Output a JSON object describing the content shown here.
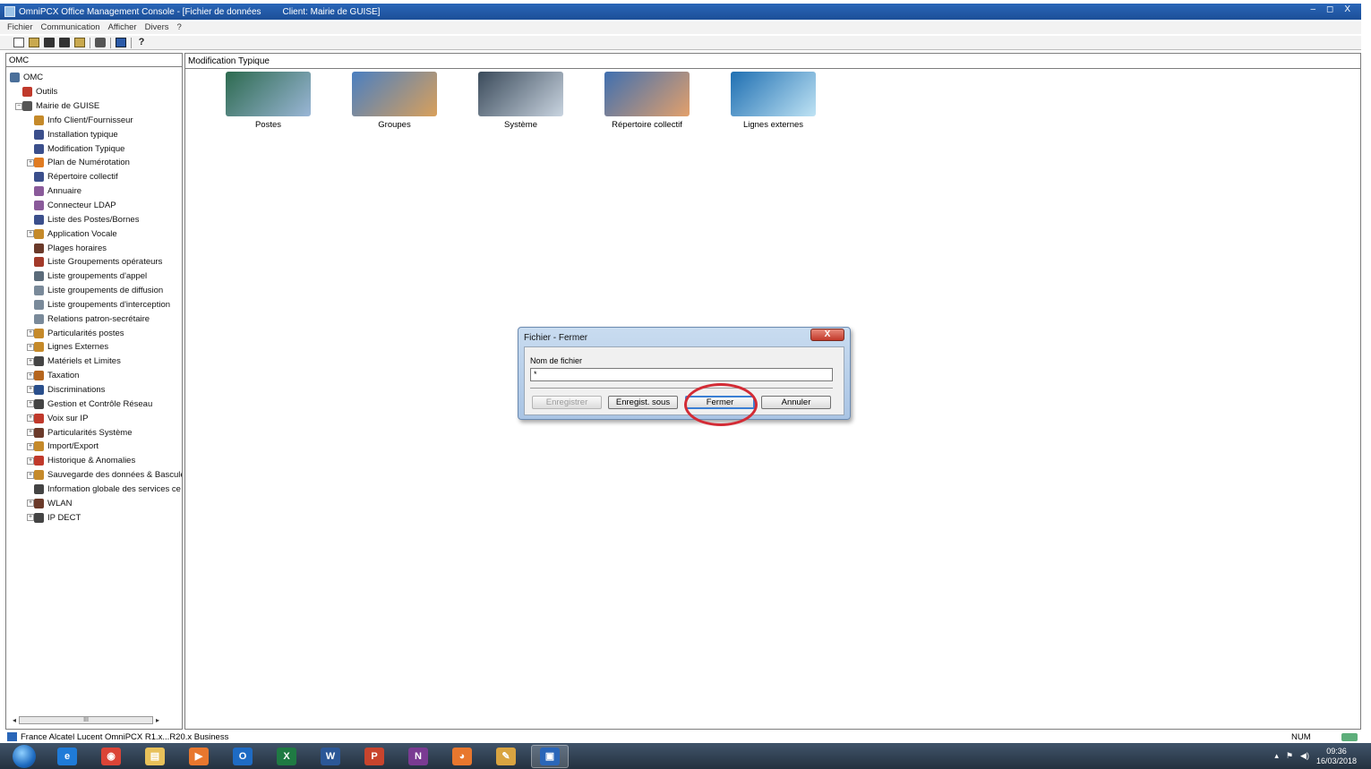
{
  "window": {
    "title": "OmniPCX Office Management Console - [Fichier de données",
    "client": "Client: Mairie de GUISE]",
    "controls": [
      "–",
      "◻",
      "X"
    ]
  },
  "menu": [
    "Fichier",
    "Communication",
    "Afficher",
    "Divers",
    "?"
  ],
  "left_panel": {
    "header": "OMC",
    "tree": [
      {
        "label": "OMC",
        "level": 0,
        "icon_color": "#4a6f9a",
        "icon": "omc-icon",
        "exp": false
      },
      {
        "label": "Outils",
        "level": 1,
        "icon_color": "#c0392b",
        "icon": "tools-icon",
        "exp": false
      },
      {
        "label": "Mairie de GUISE",
        "level": 1,
        "icon_color": "#555555",
        "icon": "computer-icon",
        "exp": true,
        "sign": "−"
      },
      {
        "label": "Info Client/Fournisseur",
        "level": 2,
        "icon_color": "#c58a2a",
        "icon": "info-icon",
        "exp": false
      },
      {
        "label": "Installation typique",
        "level": 2,
        "icon_color": "#3b4f8c",
        "icon": "wizard-icon",
        "exp": false
      },
      {
        "label": "Modification Typique",
        "level": 2,
        "icon_color": "#3b4f8c",
        "icon": "wizard-icon",
        "exp": false
      },
      {
        "label": "Plan de Numérotation",
        "level": 2,
        "icon_color": "#e07b22",
        "icon": "numbering-icon",
        "exp": true,
        "sign": "+"
      },
      {
        "label": "Répertoire collectif",
        "level": 2,
        "icon_color": "#3b4f8c",
        "icon": "directory-icon",
        "exp": false
      },
      {
        "label": "Annuaire",
        "level": 2,
        "icon_color": "#8a5a9a",
        "icon": "phonebook-icon",
        "exp": false
      },
      {
        "label": "Connecteur LDAP",
        "level": 2,
        "icon_color": "#8a5a9a",
        "icon": "ldap-icon",
        "exp": false
      },
      {
        "label": "Liste des Postes/Bornes",
        "level": 2,
        "icon_color": "#3b4f8c",
        "icon": "handset-icon",
        "exp": false
      },
      {
        "label": "Application Vocale",
        "level": 2,
        "icon_color": "#c58a2a",
        "icon": "voice-app-icon",
        "exp": true,
        "sign": "+"
      },
      {
        "label": "Plages horaires",
        "level": 2,
        "icon_color": "#6b3a2a",
        "icon": "clock-icon",
        "exp": false
      },
      {
        "label": "Liste Groupements opérateurs",
        "level": 2,
        "icon_color": "#a33a2a",
        "icon": "operator-group-icon",
        "exp": false
      },
      {
        "label": "Liste groupements d'appel",
        "level": 2,
        "icon_color": "#5b6b7a",
        "icon": "call-group-icon",
        "exp": false
      },
      {
        "label": "Liste groupements de diffusion",
        "level": 2,
        "icon_color": "#7a8a9a",
        "icon": "broadcast-group-icon",
        "exp": false
      },
      {
        "label": "Liste groupements d'interception",
        "level": 2,
        "icon_color": "#7a8a9a",
        "icon": "pickup-group-icon",
        "exp": false
      },
      {
        "label": "Relations patron-secrétaire",
        "level": 2,
        "icon_color": "#7a8a9a",
        "icon": "manager-secretary-icon",
        "exp": false
      },
      {
        "label": "Particularités postes",
        "level": 2,
        "icon_color": "#c58a2a",
        "icon": "station-features-icon",
        "exp": true,
        "sign": "+"
      },
      {
        "label": "Lignes Externes",
        "level": 2,
        "icon_color": "#c58a2a",
        "icon": "external-lines-icon",
        "exp": true,
        "sign": "+"
      },
      {
        "label": "Matériels et Limites",
        "level": 2,
        "icon_color": "#444444",
        "icon": "hardware-icon",
        "exp": true,
        "sign": "+"
      },
      {
        "label": "Taxation",
        "level": 2,
        "icon_color": "#b5651d",
        "icon": "billing-icon",
        "exp": true,
        "sign": "+"
      },
      {
        "label": "Discriminations",
        "level": 2,
        "icon_color": "#2a4f8c",
        "icon": "barring-icon",
        "exp": true,
        "sign": "+"
      },
      {
        "label": "Gestion et Contrôle Réseau",
        "level": 2,
        "icon_color": "#444444",
        "icon": "network-icon",
        "exp": true,
        "sign": "+"
      },
      {
        "label": "Voix sur IP",
        "level": 2,
        "icon_color": "#c0392b",
        "icon": "voip-icon",
        "exp": true,
        "sign": "+"
      },
      {
        "label": "Particularités Système",
        "level": 2,
        "icon_color": "#6b3a2a",
        "icon": "system-features-icon",
        "exp": true,
        "sign": "+"
      },
      {
        "label": "Import/Export",
        "level": 2,
        "icon_color": "#c58a2a",
        "icon": "import-export-icon",
        "exp": true,
        "sign": "+"
      },
      {
        "label": "Historique & Anomalies",
        "level": 2,
        "icon_color": "#c0392b",
        "icon": "history-icon",
        "exp": true,
        "sign": "+"
      },
      {
        "label": "Sauvegarde des données & Bascule",
        "level": 2,
        "icon_color": "#c58a2a",
        "icon": "backup-icon",
        "exp": true,
        "sign": "+"
      },
      {
        "label": "Information globale des services ce",
        "level": 2,
        "icon_color": "#444444",
        "icon": "services-info-icon",
        "exp": false
      },
      {
        "label": "WLAN",
        "level": 2,
        "icon_color": "#6b3a2a",
        "icon": "wlan-icon",
        "exp": true,
        "sign": "+"
      },
      {
        "label": "IP DECT",
        "level": 2,
        "icon_color": "#444444",
        "icon": "ip-dect-icon",
        "exp": true,
        "sign": "+"
      }
    ],
    "scroll_thumb": "III"
  },
  "main_panel": {
    "header": "Modification Typique",
    "icons": [
      {
        "label": "Postes",
        "icon": "phones-icon",
        "color_a": "#2d6a4f",
        "color_b": "#9ab6d6"
      },
      {
        "label": "Groupes",
        "icon": "groups-icon",
        "color_a": "#4a7fc1",
        "color_b": "#d9a05b"
      },
      {
        "label": "Système",
        "icon": "system-icon",
        "color_a": "#3a4a5a",
        "color_b": "#c9d4e0"
      },
      {
        "label": "Répertoire collectif",
        "icon": "directory-icon",
        "color_a": "#3f6fb0",
        "color_b": "#e3a06b"
      },
      {
        "label": "Lignes externes",
        "icon": "external-lines-icon",
        "color_a": "#1f6fb2",
        "color_b": "#bfe3f4"
      }
    ]
  },
  "dialog": {
    "title": "Fichier - Fermer",
    "close_label": "X",
    "field_label": "Nom de fichier",
    "field_value": "*",
    "buttons": {
      "save": "Enregistrer",
      "save_as": "Enregist. sous",
      "close": "Fermer",
      "cancel": "Annuler"
    }
  },
  "statusbar": {
    "text": "France Alcatel Lucent OmniPCX R1.x...R20.x Business",
    "num": "NUM"
  },
  "taskbar": {
    "apps": [
      {
        "icon": "ie-icon",
        "glyph": "e",
        "color": "#1f7bd8"
      },
      {
        "icon": "chrome-icon",
        "glyph": "◉",
        "color": "#db4437"
      },
      {
        "icon": "explorer-icon",
        "glyph": "▤",
        "color": "#e8c15a"
      },
      {
        "icon": "media-player-icon",
        "glyph": "▶",
        "color": "#e8772e"
      },
      {
        "icon": "outlook-icon",
        "glyph": "O",
        "color": "#1e6bc4"
      },
      {
        "icon": "excel-icon",
        "glyph": "X",
        "color": "#1f7a43"
      },
      {
        "icon": "word-icon",
        "glyph": "W",
        "color": "#2b5797"
      },
      {
        "icon": "powerpoint-icon",
        "glyph": "P",
        "color": "#c8442d"
      },
      {
        "icon": "onenote-icon",
        "glyph": "N",
        "color": "#7a3b92"
      },
      {
        "icon": "firefox-icon",
        "glyph": "◕",
        "color": "#e8772e"
      },
      {
        "icon": "paint-icon",
        "glyph": "✎",
        "color": "#d9a441"
      },
      {
        "icon": "omc-icon",
        "glyph": "▣",
        "color": "#2a66b8"
      }
    ],
    "clock_time": "09:36",
    "clock_date": "16/03/2018"
  }
}
